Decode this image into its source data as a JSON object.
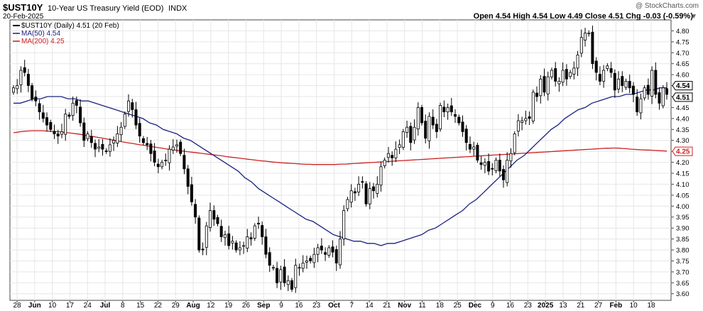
{
  "header": {
    "symbol": "$UST10Y",
    "name": "10-Year US Treasury Yield (EOD)",
    "exchange": "INDX",
    "date": "20-Feb-2025",
    "watermark": "@ StockCharts.com",
    "ohlc_line": "Open 4.54  High 4.54  Low 4.49  Close 4.51  Chg -0.03 (-0.59%)",
    "change_arrow": "▼"
  },
  "legend": {
    "price": "$UST10Y (Daily) 4.51 (20 Feb)",
    "ma50": "MA(50) 4.54",
    "ma200": "MA(200) 4.25"
  },
  "colors": {
    "ma50": "#1a237e",
    "ma200": "#cc2222",
    "up": "#ffffff",
    "down": "#000000",
    "grid": "#e6e6e6"
  },
  "chart_data": {
    "type": "ohlc-candlestick",
    "title": "$UST10Y 10-Year US Treasury Yield (EOD)",
    "y_axis": {
      "side": "right",
      "ylim": [
        3.57,
        4.85
      ],
      "ticks": [
        3.6,
        3.65,
        3.7,
        3.75,
        3.8,
        3.85,
        3.9,
        3.95,
        4.0,
        4.05,
        4.1,
        4.15,
        4.2,
        4.25,
        4.3,
        4.35,
        4.4,
        4.45,
        4.5,
        4.55,
        4.6,
        4.65,
        4.7,
        4.75,
        4.8
      ],
      "current_labels": [
        {
          "value": 4.54,
          "text": "4.54"
        },
        {
          "value": 4.51,
          "text": "4.51"
        },
        {
          "value": 4.25,
          "text": "4.25"
        }
      ]
    },
    "x_axis": {
      "tick_labels": [
        "28",
        "Jun",
        "10",
        "17",
        "24",
        "Jul",
        "8",
        "15",
        "22",
        "29",
        "Aug",
        "12",
        "19",
        "26",
        "Sep",
        "9",
        "16",
        "23",
        "Oct",
        "7",
        "14",
        "21",
        "Nov",
        "11",
        "18",
        "25",
        "Dec",
        "9",
        "16",
        "23",
        "2025",
        "13",
        "21",
        "27",
        "Feb",
        "10",
        "18"
      ],
      "bold_labels": [
        "Jun",
        "Jul",
        "Aug",
        "Sep",
        "Oct",
        "Nov",
        "Dec",
        "2025",
        "Feb"
      ]
    },
    "close": [
      4.54,
      4.55,
      4.62,
      4.61,
      4.55,
      4.49,
      4.48,
      4.43,
      4.4,
      4.37,
      4.35,
      4.33,
      4.32,
      4.34,
      4.42,
      4.41,
      4.47,
      4.46,
      4.38,
      4.3,
      4.33,
      4.29,
      4.26,
      4.27,
      4.26,
      4.25,
      4.28,
      4.3,
      4.33,
      4.36,
      4.42,
      4.48,
      4.44,
      4.37,
      4.32,
      4.29,
      4.28,
      4.24,
      4.2,
      4.18,
      4.2,
      4.21,
      4.26,
      4.27,
      4.28,
      4.24,
      4.17,
      4.09,
      4.02,
      3.95,
      3.8,
      3.8,
      3.91,
      3.98,
      3.94,
      3.92,
      3.86,
      3.87,
      3.82,
      3.84,
      3.8,
      3.81,
      3.82,
      3.86,
      3.85,
      3.91,
      3.92,
      3.86,
      3.78,
      3.73,
      3.72,
      3.65,
      3.71,
      3.65,
      3.66,
      3.62,
      3.73,
      3.72,
      3.74,
      3.75,
      3.75,
      3.78,
      3.81,
      3.8,
      3.78,
      3.81,
      3.79,
      3.74,
      3.85,
      3.98,
      4.03,
      4.07,
      4.06,
      4.1,
      4.11,
      4.01,
      4.08,
      4.07,
      4.1,
      4.18,
      4.21,
      4.24,
      4.22,
      4.26,
      4.28,
      4.34,
      4.36,
      4.29,
      4.36,
      4.45,
      4.38,
      4.31,
      4.41,
      4.37,
      4.34,
      4.46,
      4.43,
      4.45,
      4.43,
      4.41,
      4.38,
      4.34,
      4.29,
      4.26,
      4.27,
      4.21,
      4.19,
      4.2,
      4.16,
      4.17,
      4.21,
      4.16,
      4.12,
      4.21,
      4.24,
      4.33,
      4.39,
      4.39,
      4.4,
      4.4,
      4.52,
      4.5,
      4.58,
      4.52,
      4.59,
      4.62,
      4.57,
      4.57,
      4.62,
      4.58,
      4.61,
      4.63,
      4.69,
      4.77,
      4.79,
      4.79,
      4.65,
      4.61,
      4.57,
      4.62,
      4.64,
      4.61,
      4.53,
      4.58,
      4.55,
      4.57,
      4.54,
      4.51,
      4.43,
      4.49,
      4.54,
      4.51,
      4.62,
      4.51,
      4.47,
      4.54,
      4.51
    ],
    "ma50": [
      4.47,
      4.47,
      4.48,
      4.49,
      4.49,
      4.5,
      4.5,
      4.5,
      4.49,
      4.49,
      4.48,
      4.48,
      4.47,
      4.46,
      4.45,
      4.44,
      4.43,
      4.42,
      4.41,
      4.4,
      4.38,
      4.37,
      4.35,
      4.34,
      4.33,
      4.31,
      4.3,
      4.28,
      4.26,
      4.24,
      4.22,
      4.2,
      4.18,
      4.16,
      4.13,
      4.11,
      4.08,
      4.06,
      4.04,
      4.02,
      4.0,
      3.98,
      3.96,
      3.94,
      3.93,
      3.91,
      3.89,
      3.87,
      3.86,
      3.85,
      3.84,
      3.84,
      3.83,
      3.83,
      3.82,
      3.83,
      3.83,
      3.84,
      3.85,
      3.86,
      3.87,
      3.89,
      3.9,
      3.92,
      3.94,
      3.96,
      3.98,
      4.01,
      4.03,
      4.06,
      4.09,
      4.12,
      4.15,
      4.18,
      4.21,
      4.23,
      4.26,
      4.29,
      4.32,
      4.35,
      4.37,
      4.4,
      4.42,
      4.44,
      4.45,
      4.47,
      4.48,
      4.49,
      4.5,
      4.5,
      4.51,
      4.51,
      4.52,
      4.53,
      4.53,
      4.54,
      4.54
    ],
    "ma50_start_index": 88,
    "ma200": [
      4.335,
      4.337,
      4.34,
      4.342,
      4.343,
      4.344,
      4.344,
      4.344,
      4.344,
      4.343,
      4.342,
      4.341,
      4.34,
      4.339,
      4.337,
      4.335,
      4.333,
      4.331,
      4.329,
      4.326,
      4.323,
      4.32,
      4.318,
      4.315,
      4.312,
      4.309,
      4.306,
      4.303,
      4.3,
      4.297,
      4.294,
      4.291,
      4.288,
      4.286,
      4.283,
      4.28,
      4.278,
      4.275,
      4.272,
      4.27,
      4.267,
      4.265,
      4.262,
      4.26,
      4.258,
      4.255,
      4.253,
      4.251,
      4.249,
      4.247,
      4.245,
      4.243,
      4.241,
      4.239,
      4.237,
      4.235,
      4.233,
      4.231,
      4.229,
      4.226,
      4.224,
      4.222,
      4.22,
      4.218,
      4.216,
      4.214,
      4.212,
      4.21,
      4.208,
      4.206,
      4.205,
      4.203,
      4.201,
      4.2,
      4.198,
      4.197,
      4.196,
      4.195,
      4.194,
      4.193,
      4.192,
      4.191,
      4.191,
      4.19,
      4.19,
      4.19,
      4.19,
      4.19,
      4.19,
      4.19,
      4.191,
      4.192,
      4.192,
      4.193,
      4.194,
      4.195,
      4.196,
      4.197,
      4.198,
      4.199,
      4.2,
      4.201,
      4.202,
      4.203,
      4.204,
      4.205,
      4.206,
      4.207,
      4.208,
      4.209,
      4.21,
      4.211,
      4.212,
      4.213,
      4.214,
      4.215,
      4.216,
      4.217,
      4.218,
      4.219,
      4.22,
      4.221,
      4.222,
      4.223,
      4.224,
      4.225,
      4.226,
      4.227,
      4.228,
      4.229,
      4.23,
      4.231,
      4.232,
      4.233,
      4.234,
      4.235,
      4.236,
      4.237,
      4.238,
      4.239,
      4.24,
      4.241,
      4.242,
      4.243,
      4.244,
      4.245,
      4.246,
      4.247,
      4.248,
      4.249,
      4.25,
      4.251,
      4.252,
      4.253,
      4.254,
      4.255,
      4.256,
      4.257,
      4.258,
      4.259,
      4.26,
      4.261,
      4.262,
      4.263,
      4.264,
      4.264,
      4.265,
      4.265,
      4.264,
      4.263,
      4.262,
      4.26,
      4.259,
      4.258,
      4.257,
      4.256,
      4.256,
      4.255,
      4.254,
      4.253,
      4.252,
      4.251
    ]
  }
}
